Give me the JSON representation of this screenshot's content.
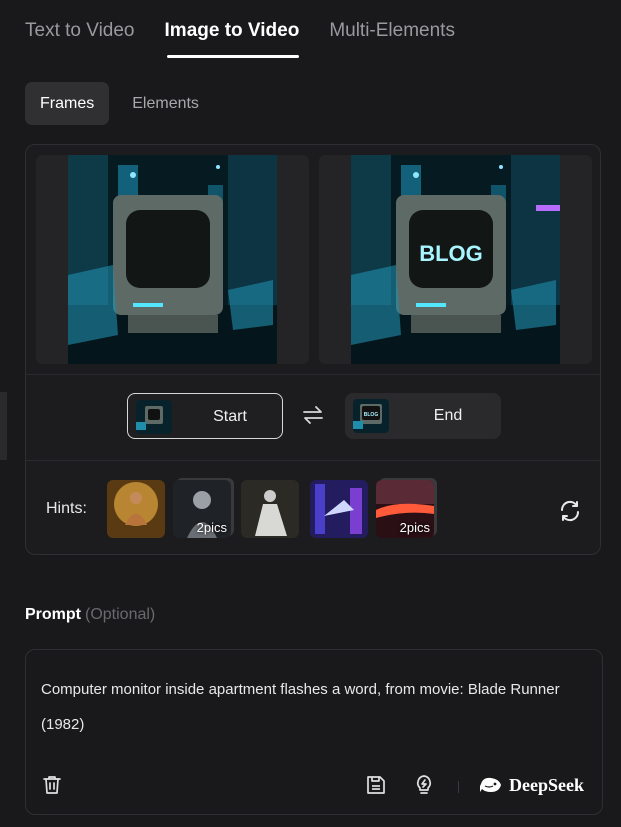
{
  "tabs": [
    "Text to Video",
    "Image to Video",
    "Multi-Elements"
  ],
  "subtabs": [
    "Frames",
    "Elements"
  ],
  "frames": {
    "start_label": "Start",
    "end_label": "End",
    "end_screen_text": "BLOG",
    "end_thumb_text": "BLOG"
  },
  "hints": {
    "label": "Hints:",
    "items": [
      {
        "badge": ""
      },
      {
        "badge": "2pics"
      },
      {
        "badge": ""
      },
      {
        "badge": ""
      },
      {
        "badge": "2pics"
      }
    ]
  },
  "prompt": {
    "title": "Prompt",
    "optional": "(Optional)",
    "text": "Computer monitor inside apartment flashes a word, from movie: Blade Runner (1982)"
  },
  "model": {
    "name": "DeepSeek"
  },
  "icons": [
    "swap-icon",
    "refresh-icon",
    "trash-icon",
    "save-icon",
    "lightbulb-icon",
    "deepseek-whale-icon"
  ],
  "colors": {
    "background": "#19191b",
    "accent_cyan": "#52e6ff"
  }
}
